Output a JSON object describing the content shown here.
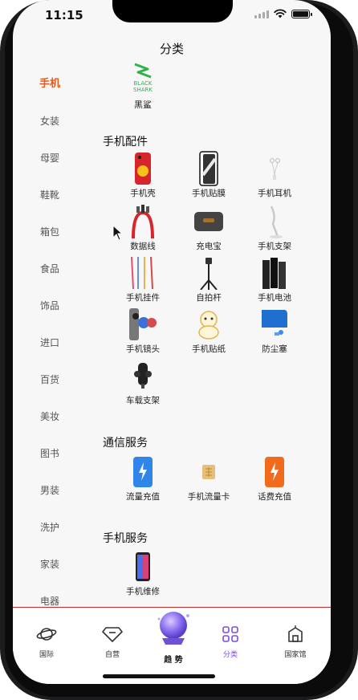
{
  "status": {
    "time": "11:15"
  },
  "nav": {
    "title": "分类"
  },
  "sidebar": {
    "items": [
      {
        "label": "手机",
        "active": true
      },
      {
        "label": "女装"
      },
      {
        "label": "母婴"
      },
      {
        "label": "鞋靴"
      },
      {
        "label": "箱包"
      },
      {
        "label": "食品"
      },
      {
        "label": "饰品"
      },
      {
        "label": "进口"
      },
      {
        "label": "百货"
      },
      {
        "label": "美妆"
      },
      {
        "label": "图书"
      },
      {
        "label": "男装"
      },
      {
        "label": "洗护"
      },
      {
        "label": "家装"
      },
      {
        "label": "电器"
      }
    ]
  },
  "brand": {
    "logo_text_1": "BLACK",
    "logo_text_2": "SHARK",
    "label": "黑鲨",
    "logo_color": "#2db34a"
  },
  "sections": {
    "accessories": {
      "title": "手机配件",
      "items": [
        "手机壳",
        "手机贴膜",
        "手机耳机",
        "数据线",
        "充电宝",
        "手机支架",
        "手机挂件",
        "自拍杆",
        "手机电池",
        "手机镜头",
        "手机贴纸",
        "防尘塞",
        "车载支架"
      ]
    },
    "telecom": {
      "title": "通信服务",
      "items": [
        "流量充值",
        "手机流量卡",
        "话费充值"
      ]
    },
    "service": {
      "title": "手机服务",
      "items": [
        "手机维修"
      ]
    }
  },
  "tabbar": {
    "tabs": [
      {
        "label": "国际",
        "icon": "planet-icon"
      },
      {
        "label": "自营",
        "icon": "diamond-icon"
      },
      {
        "label": "趋 势",
        "icon": "crystal-icon"
      },
      {
        "label": "分类",
        "icon": "grid-icon",
        "active": true
      },
      {
        "label": "国家馆",
        "icon": "building-icon"
      }
    ],
    "active_color": "#7b4ee0"
  },
  "colors": {
    "accent": "#e85a1c",
    "blue_item": "#2f86e8",
    "orange_item": "#f26b1d"
  }
}
